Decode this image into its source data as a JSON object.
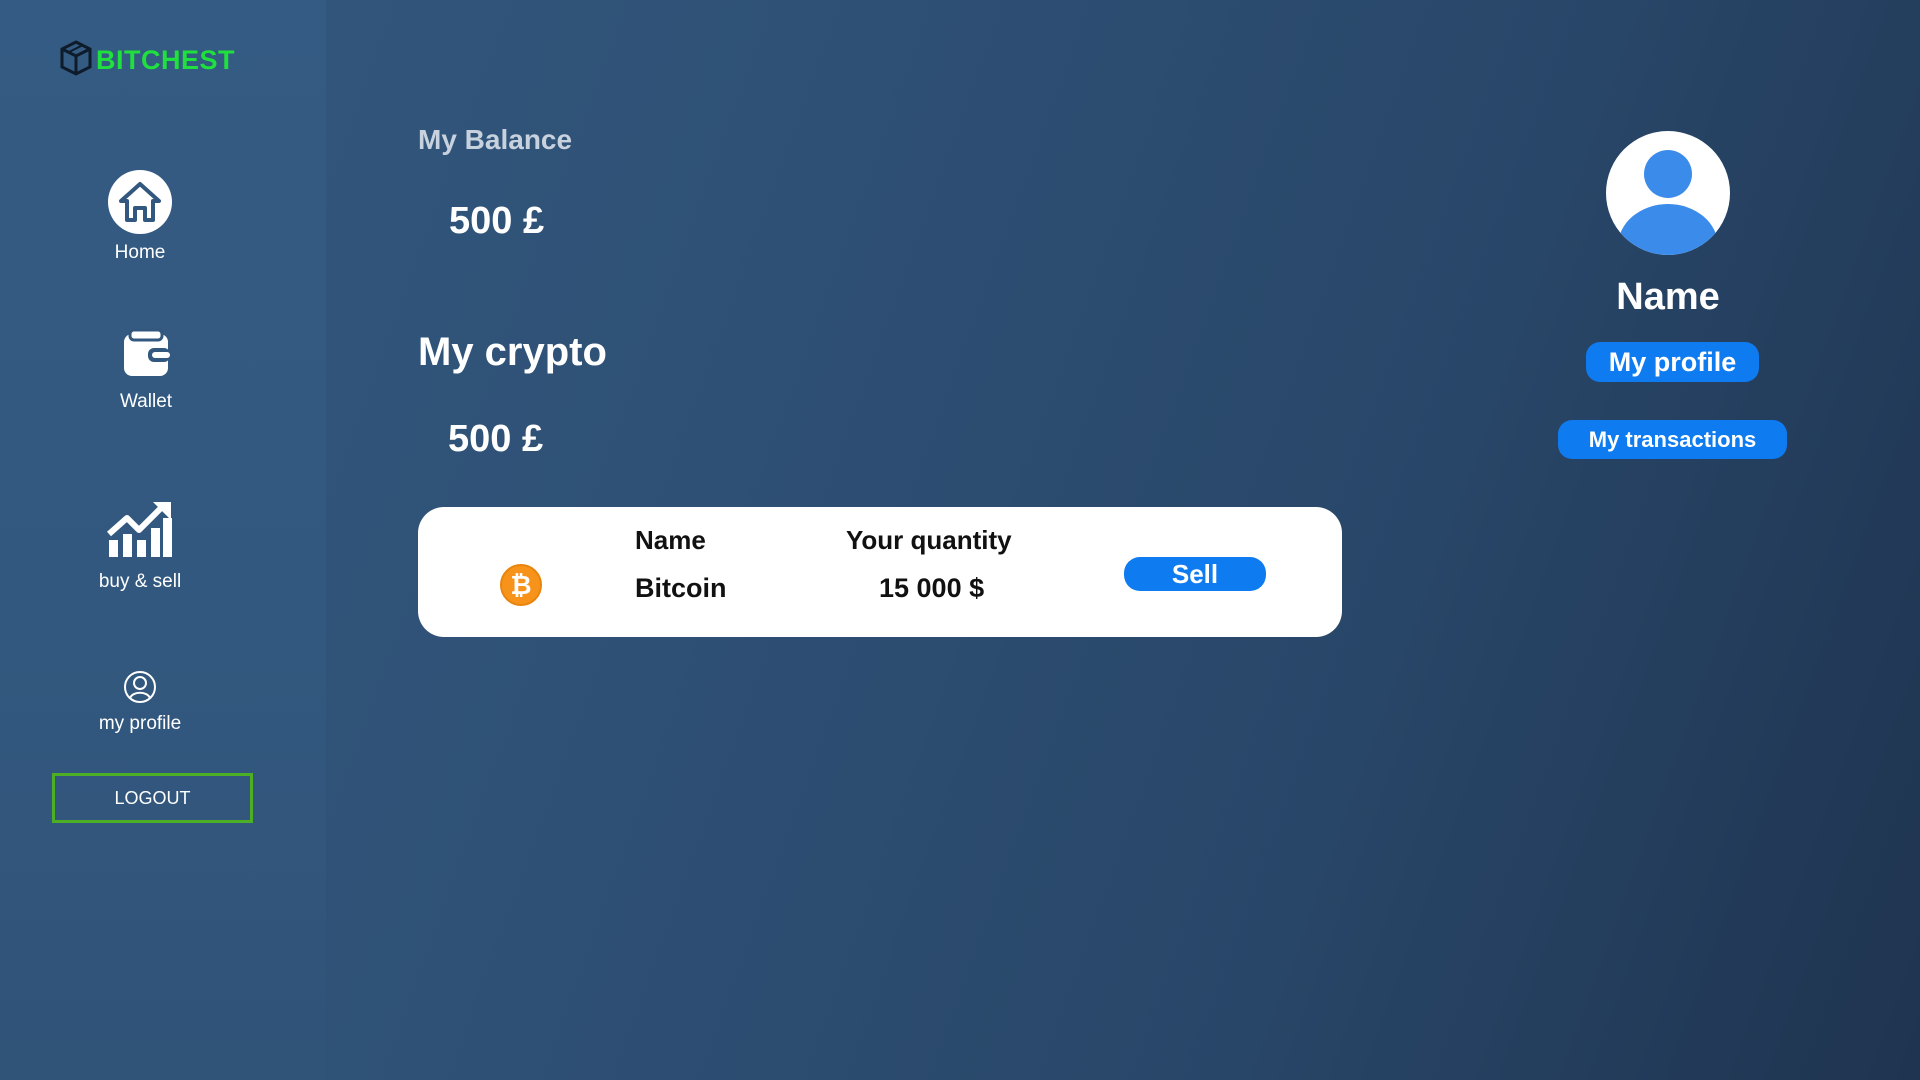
{
  "app": {
    "logo_text": "BITCHEST",
    "logo_color": "#1fe03c"
  },
  "sidebar": {
    "items": [
      {
        "label": "Home",
        "icon": "home-icon"
      },
      {
        "label": "Wallet",
        "icon": "wallet-icon"
      },
      {
        "label": "buy & sell",
        "icon": "chart-growth-icon"
      },
      {
        "label": "my profile",
        "icon": "user-circle-icon"
      }
    ],
    "logout_label": "LOGOUT"
  },
  "main": {
    "balance_title": "My Balance",
    "balance_value": "500 £",
    "crypto_title": "My crypto",
    "crypto_value": "500 £",
    "table": {
      "headers": {
        "name": "Name",
        "quantity": "Your quantity"
      },
      "rows": [
        {
          "icon": "bitcoin-icon",
          "name": "Bitcoin",
          "quantity": "15 000 $",
          "action": "Sell"
        }
      ]
    }
  },
  "profile": {
    "name": "Name",
    "my_profile_label": "My profile",
    "my_transactions_label": "My transactions"
  },
  "colors": {
    "accent": "#0f7bf0",
    "logout_border": "#4caf25",
    "bitcoin": "#f7931a"
  }
}
